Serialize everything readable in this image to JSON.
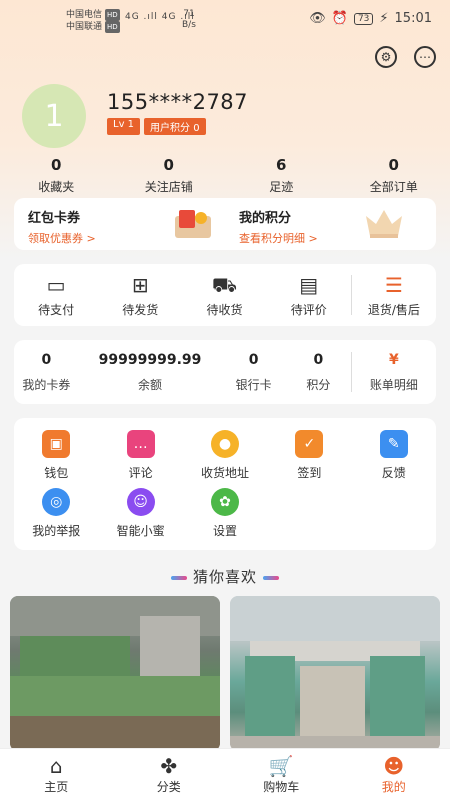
{
  "status_bar": {
    "carrier1": "中国电信",
    "carrier2": "中国联通",
    "hd": "HD",
    "signal": "4G .ıll 4G .ıll",
    "net_speed": "71",
    "net_unit": "B/s",
    "battery": "73",
    "time": "15:01"
  },
  "profile": {
    "avatar_text": "1",
    "phone": "155****2787",
    "level": "Lv 1",
    "points_badge": "用户积分 0"
  },
  "stats": [
    {
      "num": "0",
      "label": "收藏夹"
    },
    {
      "num": "0",
      "label": "关注店铺"
    },
    {
      "num": "6",
      "label": "足迹"
    },
    {
      "num": "0",
      "label": "全部订单"
    }
  ],
  "promo": {
    "coupon_title": "红包卡券",
    "coupon_link": "领取优惠券 >",
    "points_title": "我的积分",
    "points_link": "查看积分明细 >"
  },
  "orders": [
    {
      "label": "待支付",
      "icon": "wallet-icon"
    },
    {
      "label": "待发货",
      "icon": "box-icon"
    },
    {
      "label": "待收货",
      "icon": "truck-icon"
    },
    {
      "label": "待评价",
      "icon": "comment-icon"
    },
    {
      "label": "退货/售后",
      "icon": "refund-icon"
    }
  ],
  "wallet": [
    {
      "num": "0",
      "label": "我的卡券"
    },
    {
      "num": "99999999.99",
      "label": "余额"
    },
    {
      "num": "0",
      "label": "银行卡"
    },
    {
      "num": "0",
      "label": "积分"
    },
    {
      "label": "账单明细"
    }
  ],
  "tools": [
    {
      "label": "钱包",
      "icon": "wallet-icon",
      "color": "#f07a2e"
    },
    {
      "label": "评论",
      "icon": "chat-icon",
      "color": "#e9447d"
    },
    {
      "label": "收货地址",
      "icon": "location-icon",
      "color": "#f6b228"
    },
    {
      "label": "签到",
      "icon": "calendar-icon",
      "color": "#f28a2c"
    },
    {
      "label": "反馈",
      "icon": "feedback-icon",
      "color": "#3c8ff0"
    },
    {
      "label": "我的举报",
      "icon": "report-icon",
      "color": "#3c8ff0"
    },
    {
      "label": "智能小蜜",
      "icon": "assistant-icon",
      "color": "#8a4cf0"
    },
    {
      "label": "设置",
      "icon": "settings-icon",
      "color": "#4cb848"
    }
  ],
  "guess_title": "猜你喜欢",
  "nav": [
    {
      "label": "主页",
      "icon": "home-icon"
    },
    {
      "label": "分类",
      "icon": "category-icon"
    },
    {
      "label": "购物车",
      "icon": "cart-icon"
    },
    {
      "label": "我的",
      "icon": "user-icon",
      "active": true
    }
  ],
  "colors": {
    "accent": "#e8622c",
    "header_bg": "#fde7d3"
  }
}
